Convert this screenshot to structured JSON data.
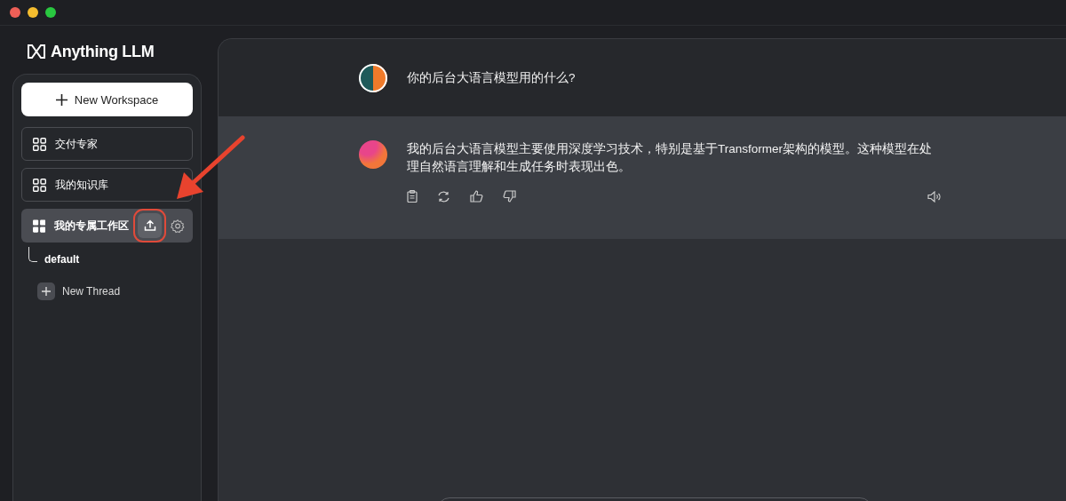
{
  "logo": {
    "text": "Anything LLM"
  },
  "sidebar": {
    "new_workspace_button": "New Workspace",
    "workspaces": [
      {
        "name": "交付专家",
        "selected": false
      },
      {
        "name": "我的知识库",
        "selected": false
      },
      {
        "name": "我的专属工作区",
        "selected": true,
        "upload_highlighted": true,
        "threads": [
          {
            "label": "default"
          }
        ],
        "new_thread_button": "New Thread"
      }
    ]
  },
  "messages": [
    {
      "kind": "user",
      "text": "你的后台大语言模型用的什么?"
    },
    {
      "kind": "assistant",
      "text": "我的后台大语言模型主要使用深度学习技术，特别是基于Transformer架构的模型。这种模型在处理自然语言理解和生成任务时表现出色。"
    }
  ]
}
